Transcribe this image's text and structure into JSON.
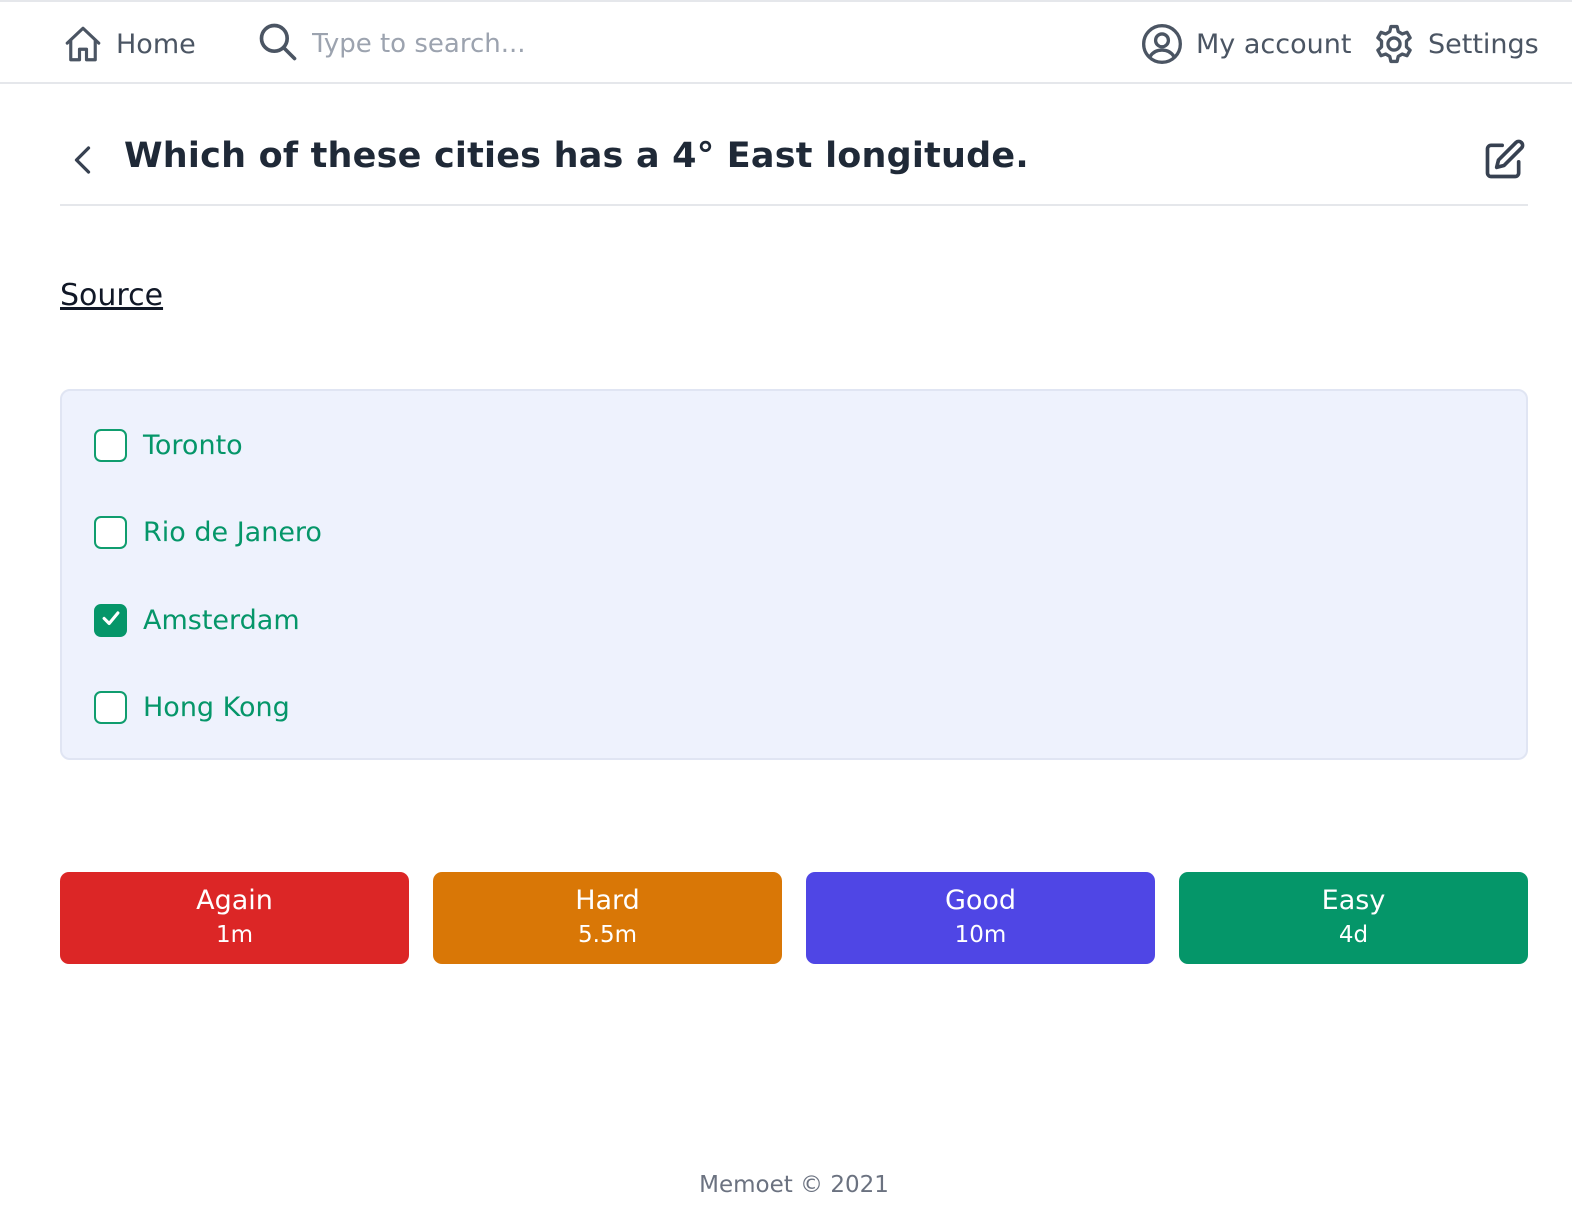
{
  "nav": {
    "home_label": "Home",
    "search_placeholder": "Type to search...",
    "account_label": "My account",
    "settings_label": "Settings"
  },
  "card": {
    "title": "Which of these cities has a 4° East longitude.",
    "source_link": "Source"
  },
  "options": [
    {
      "label": "Toronto",
      "checked": false
    },
    {
      "label": "Rio de Janero",
      "checked": false
    },
    {
      "label": "Amsterdam",
      "checked": true
    },
    {
      "label": "Hong Kong",
      "checked": false
    }
  ],
  "ratings": [
    {
      "name": "Again",
      "interval": "1m",
      "color": "#dc2626"
    },
    {
      "name": "Hard",
      "interval": "5.5m",
      "color": "#d97706"
    },
    {
      "name": "Good",
      "interval": "10m",
      "color": "#4f46e5"
    },
    {
      "name": "Easy",
      "interval": "4d",
      "color": "#059669"
    }
  ],
  "footer": {
    "text": "Memoet © 2021"
  },
  "icons": {
    "home": "home-icon",
    "search": "search-icon",
    "account": "user-circle-icon",
    "settings": "gear-icon",
    "back": "chevron-left-icon",
    "edit": "edit-icon",
    "check": "check-icon"
  }
}
